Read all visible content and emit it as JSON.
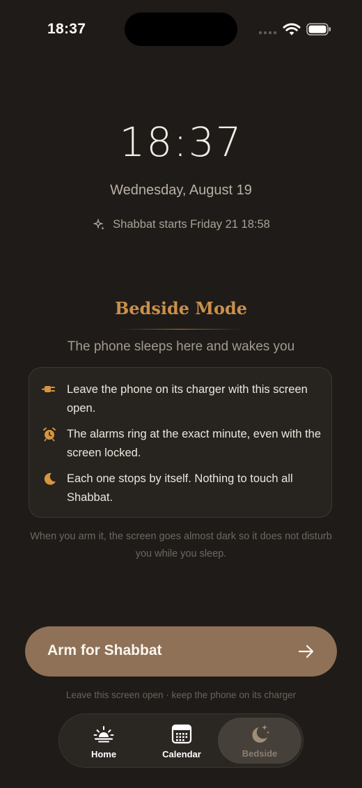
{
  "status_bar": {
    "time": "18:37"
  },
  "clock": {
    "time": "18:37",
    "date": "Wednesday, August 19"
  },
  "shabbat_notice": {
    "icon": "sparkle-icon",
    "text": "Shabbat starts Friday 21 18:58"
  },
  "bedside": {
    "title": "Bedside Mode",
    "subtitle": "The phone sleeps here and wakes you",
    "items": [
      {
        "icon": "plug-icon",
        "text": "Leave the phone on its charger with this screen open."
      },
      {
        "icon": "alarm-clock-icon",
        "text": "The alarms ring at the exact minute, even with the screen locked."
      },
      {
        "icon": "moon-icon",
        "text": "Each one stops by itself. Nothing to touch all Shabbat."
      }
    ],
    "note": "When you arm it, the screen goes almost dark so it does not disturb you while you sleep."
  },
  "arm_button": {
    "label": "Arm for Shabbat"
  },
  "hint": "Leave this screen open · keep the phone on its charger",
  "tabs": [
    {
      "label": "Home",
      "icon": "sunrise-icon",
      "active": false
    },
    {
      "label": "Calendar",
      "icon": "calendar-icon",
      "active": false
    },
    {
      "label": "Bedside",
      "icon": "moon-stars-icon",
      "active": true
    }
  ],
  "colors": {
    "background": "#1f1b18",
    "accent": "#c9904c",
    "button": "#8f7157"
  }
}
